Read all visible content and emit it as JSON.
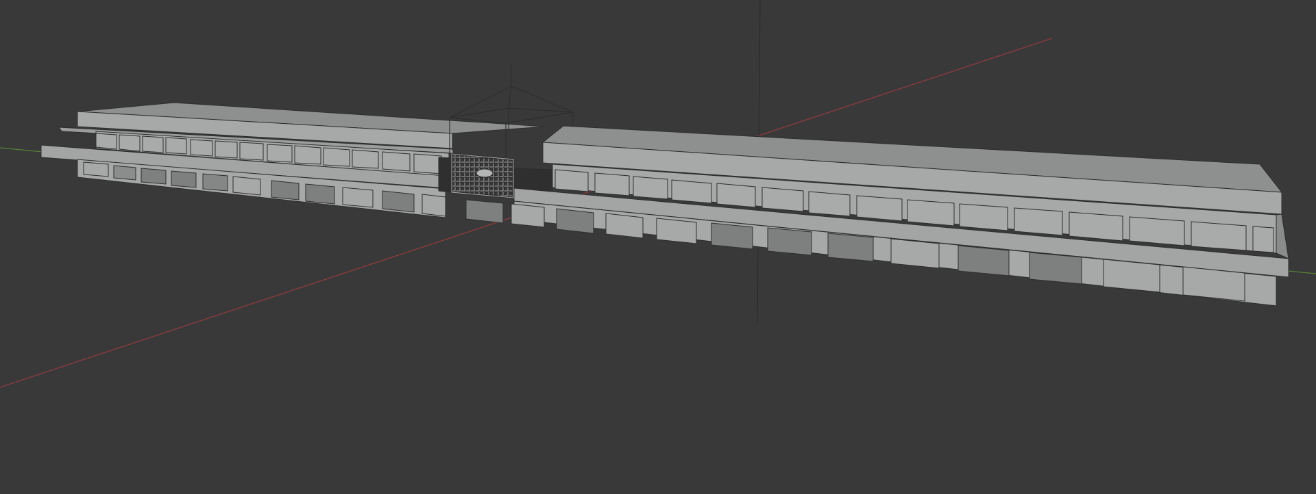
{
  "app": {
    "window": "3D Viewport",
    "shading": "solid",
    "object": "building"
  },
  "colors": {
    "background": "#393939",
    "x_axis": "#9a3b42",
    "y_axis": "#5d8b3a",
    "z_axis": "#2a2a2a",
    "face_light": "#a7a8a8",
    "face_top": "#8e8f8f",
    "face_dark": "#6e6f6f",
    "edge": "#2e2e2e"
  }
}
